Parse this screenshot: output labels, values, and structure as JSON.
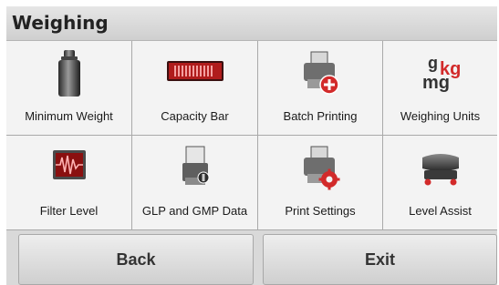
{
  "header": {
    "title": "Weighing"
  },
  "tiles": [
    {
      "label": "Minimum Weight",
      "icon": "weight-icon"
    },
    {
      "label": "Capacity Bar",
      "icon": "capacity-bar-icon"
    },
    {
      "label": "Batch Printing",
      "icon": "batch-printing-icon"
    },
    {
      "label": "Weighing Units",
      "icon": "weighing-units-icon"
    },
    {
      "label": "Filter Level",
      "icon": "filter-level-icon"
    },
    {
      "label": "GLP and GMP Data",
      "icon": "glp-gmp-data-icon"
    },
    {
      "label": "Print Settings",
      "icon": "print-settings-icon"
    },
    {
      "label": "Level Assist",
      "icon": "level-assist-icon"
    }
  ],
  "units_icon_text": {
    "g": "g",
    "kg": "kg",
    "mg": "mg"
  },
  "footer": {
    "back_label": "Back",
    "exit_label": "Exit"
  },
  "colors": {
    "accent_red": "#d22a2a",
    "tile_bg": "#f3f3f3",
    "grid_line": "#a9a9a9"
  }
}
